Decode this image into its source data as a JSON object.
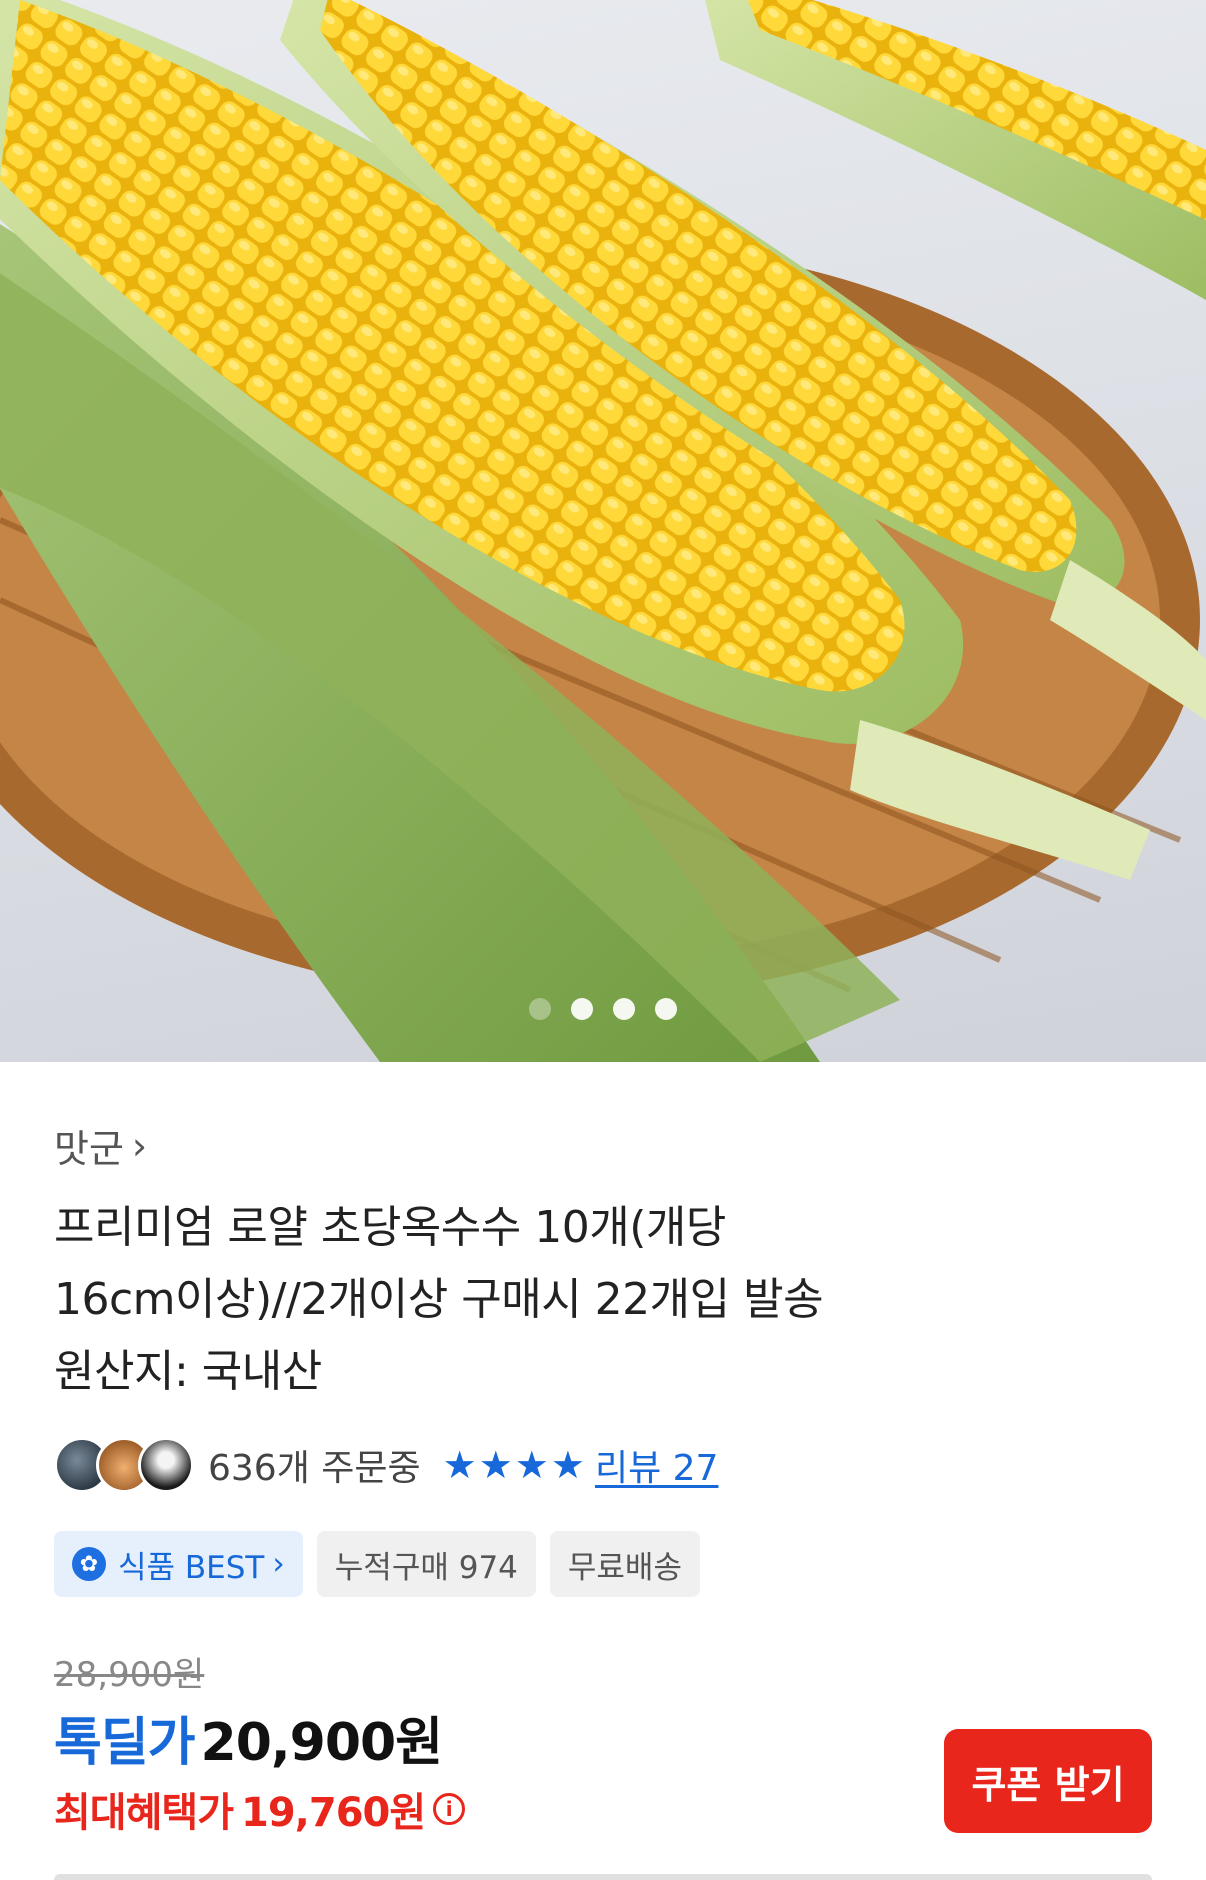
{
  "carousel": {
    "image_label": "corn",
    "slide_count": 4,
    "active_index": 0
  },
  "product": {
    "seller": "맛군",
    "title_lines": [
      "프리미엄 로얄 초당옥수수 10개(개당",
      "16cm이상)//2개이상 구매시 22개입 발송",
      "원산지: 국내산"
    ],
    "order_count": "636개 주문중",
    "rating_stars": 4,
    "review_link": "리뷰 27",
    "chips": {
      "best": "식품 BEST",
      "cumulative": "누적구매 974",
      "shipping": "무료배송"
    },
    "original_price": "28,900원",
    "deal_label": "톡딜가",
    "deal_price": "20,900원",
    "max_benefit_label": "최대혜택가",
    "max_benefit_price": "19,760원",
    "coupon_button": "쿠폰 받기"
  },
  "colors": {
    "accent_blue": "#1769d9",
    "accent_red": "#e8261c"
  },
  "icons": {
    "chevron": "chevron-right-icon",
    "star": "star-icon",
    "badge": "best-badge-icon",
    "info": "info-icon"
  }
}
